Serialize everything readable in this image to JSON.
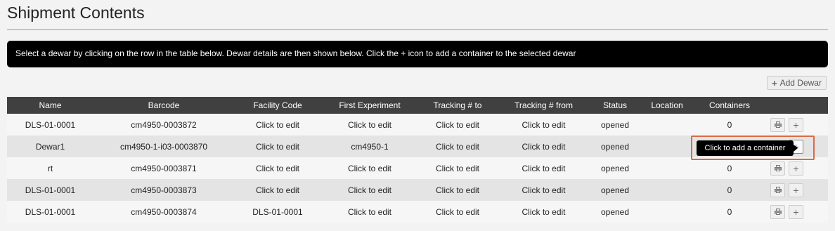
{
  "page": {
    "title": "Shipment Contents",
    "info": "Select a dewar by clicking on the row in the table below. Dewar details are then shown below. Click the + icon to add a container to the selected dewar",
    "add_dewar_label": "Add Dewar",
    "add_dewar_icon": "plus-icon"
  },
  "table": {
    "headers": [
      "Name",
      "Barcode",
      "Facility Code",
      "First Experiment",
      "Tracking # to",
      "Tracking # from",
      "Status",
      "Location",
      "Containers"
    ],
    "rows": [
      {
        "name": "DLS-01-0001",
        "barcode": "cm4950-0003872",
        "facility_code": "Click to edit",
        "first_experiment": "Click to edit",
        "tracking_to": "Click to edit",
        "tracking_from": "Click to edit",
        "status": "opened",
        "location": "",
        "containers": "0"
      },
      {
        "name": "Dewar1",
        "barcode": "cm4950-1-i03-0003870",
        "facility_code": "Click to edit",
        "first_experiment": "cm4950-1",
        "tracking_to": "Click to edit",
        "tracking_from": "Click to edit",
        "status": "opened",
        "location": "",
        "containers": ""
      },
      {
        "name": "rt",
        "barcode": "cm4950-0003871",
        "facility_code": "Click to edit",
        "first_experiment": "Click to edit",
        "tracking_to": "Click to edit",
        "tracking_from": "Click to edit",
        "status": "opened",
        "location": "",
        "containers": "0"
      },
      {
        "name": "DLS-01-0001",
        "barcode": "cm4950-0003873",
        "facility_code": "Click to edit",
        "first_experiment": "Click to edit",
        "tracking_to": "Click to edit",
        "tracking_from": "Click to edit",
        "status": "opened",
        "location": "",
        "containers": "0"
      },
      {
        "name": "DLS-01-0001",
        "barcode": "cm4950-0003874",
        "facility_code": "DLS-01-0001",
        "first_experiment": "Click to edit",
        "tracking_to": "Click to edit",
        "tracking_from": "Click to edit",
        "status": "opened",
        "location": "",
        "containers": "0"
      }
    ],
    "row_icons": {
      "print": "print-icon",
      "add": "plus-icon"
    }
  },
  "tooltip": {
    "text": "Click to add a container"
  },
  "colors": {
    "header_bg": "#404040",
    "info_bg": "#000000",
    "highlight": "#d96b45"
  }
}
